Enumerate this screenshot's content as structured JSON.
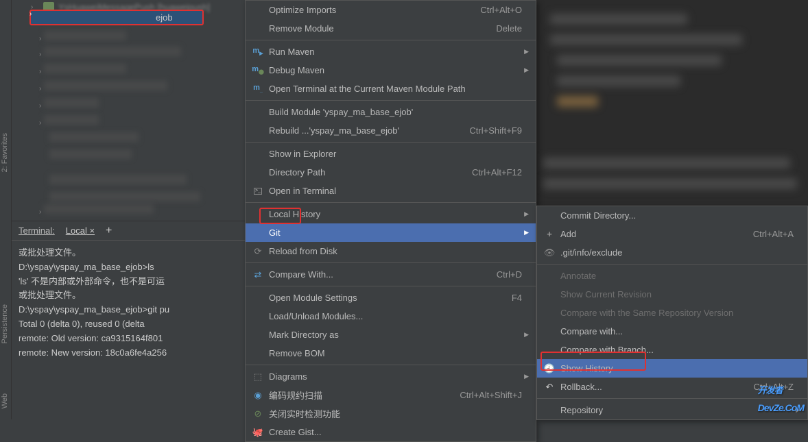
{
  "sidebar": {
    "tabs": [
      "2: Favorites",
      "Persistence",
      "Web"
    ]
  },
  "tree": {
    "highlighted_label": "ejob",
    "obscured_top": "YsHuaweiMessagePush [huaweipush]"
  },
  "terminal": {
    "title": "Terminal:",
    "active_tab": "Local",
    "close_x": "×",
    "plus": "+",
    "lines": [
      "或批处理文件。",
      "",
      "D:\\yspay\\yspay_ma_base_ejob>ls",
      "'ls' 不是内部或外部命令，也不是可运",
      "或批处理文件。",
      "",
      "D:\\yspay\\yspay_ma_base_ejob>git pu",
      "Total 0 (delta 0), reused 0 (delta",
      "remote: Old version: ca9315164f801",
      "remote: New version: 18c0a6fe4a256"
    ]
  },
  "menu": {
    "items": [
      {
        "label": "Optimize Imports",
        "shortcut": "Ctrl+Alt+O"
      },
      {
        "label": "Remove Module",
        "shortcut": "Delete"
      },
      {
        "sep": true
      },
      {
        "icon": "maven",
        "label": "Run Maven",
        "arrow": true
      },
      {
        "icon": "maven-debug",
        "label": "Debug Maven",
        "arrow": true
      },
      {
        "icon": "maven-terminal",
        "label": "Open Terminal at the Current Maven Module Path"
      },
      {
        "sep": true
      },
      {
        "label": "Build Module 'yspay_ma_base_ejob'"
      },
      {
        "label": "Rebuild ...'yspay_ma_base_ejob'",
        "shortcut": "Ctrl+Shift+F9"
      },
      {
        "sep": true
      },
      {
        "label": "Show in Explorer"
      },
      {
        "label": "Directory Path",
        "shortcut": "Ctrl+Alt+F12"
      },
      {
        "icon": "terminal",
        "label": "Open in Terminal"
      },
      {
        "sep": true
      },
      {
        "label": "Local History",
        "arrow": true
      },
      {
        "label": "Git",
        "arrow": true,
        "highlighted": true
      },
      {
        "icon": "reload",
        "label": "Reload from Disk"
      },
      {
        "sep": true
      },
      {
        "icon": "compare",
        "label": "Compare With...",
        "shortcut": "Ctrl+D"
      },
      {
        "sep": true
      },
      {
        "label": "Open Module Settings",
        "shortcut": "F4"
      },
      {
        "label": "Load/Unload Modules..."
      },
      {
        "label": "Mark Directory as",
        "arrow": true
      },
      {
        "label": "Remove BOM"
      },
      {
        "sep": true
      },
      {
        "icon": "diagrams",
        "label": "Diagrams",
        "arrow": true
      },
      {
        "icon": "scan",
        "label": "编码规约扫描",
        "shortcut": "Ctrl+Alt+Shift+J"
      },
      {
        "icon": "toggle",
        "label": "关闭实时检测功能"
      },
      {
        "icon": "github",
        "label": "Create Gist..."
      }
    ]
  },
  "submenu": {
    "items": [
      {
        "label": "Commit Directory..."
      },
      {
        "icon": "plus",
        "label": "Add",
        "shortcut": "Ctrl+Alt+A"
      },
      {
        "icon": "exclude",
        "label": ".git/info/exclude"
      },
      {
        "sep": true
      },
      {
        "label": "Annotate",
        "disabled": true
      },
      {
        "label": "Show Current Revision",
        "disabled": true
      },
      {
        "label": "Compare with the Same Repository Version",
        "disabled": true
      },
      {
        "label": "Compare with..."
      },
      {
        "label": "Compare with Branch..."
      },
      {
        "icon": "history",
        "label": "Show History",
        "highlighted": true
      },
      {
        "icon": "rollback",
        "label": "Rollback...",
        "shortcut": "Ctrl+Alt+Z"
      },
      {
        "sep": true
      },
      {
        "label": "Repository",
        "arrow": true
      }
    ]
  },
  "watermark": "开发者",
  "watermark_sub": "DevZe.CoM"
}
